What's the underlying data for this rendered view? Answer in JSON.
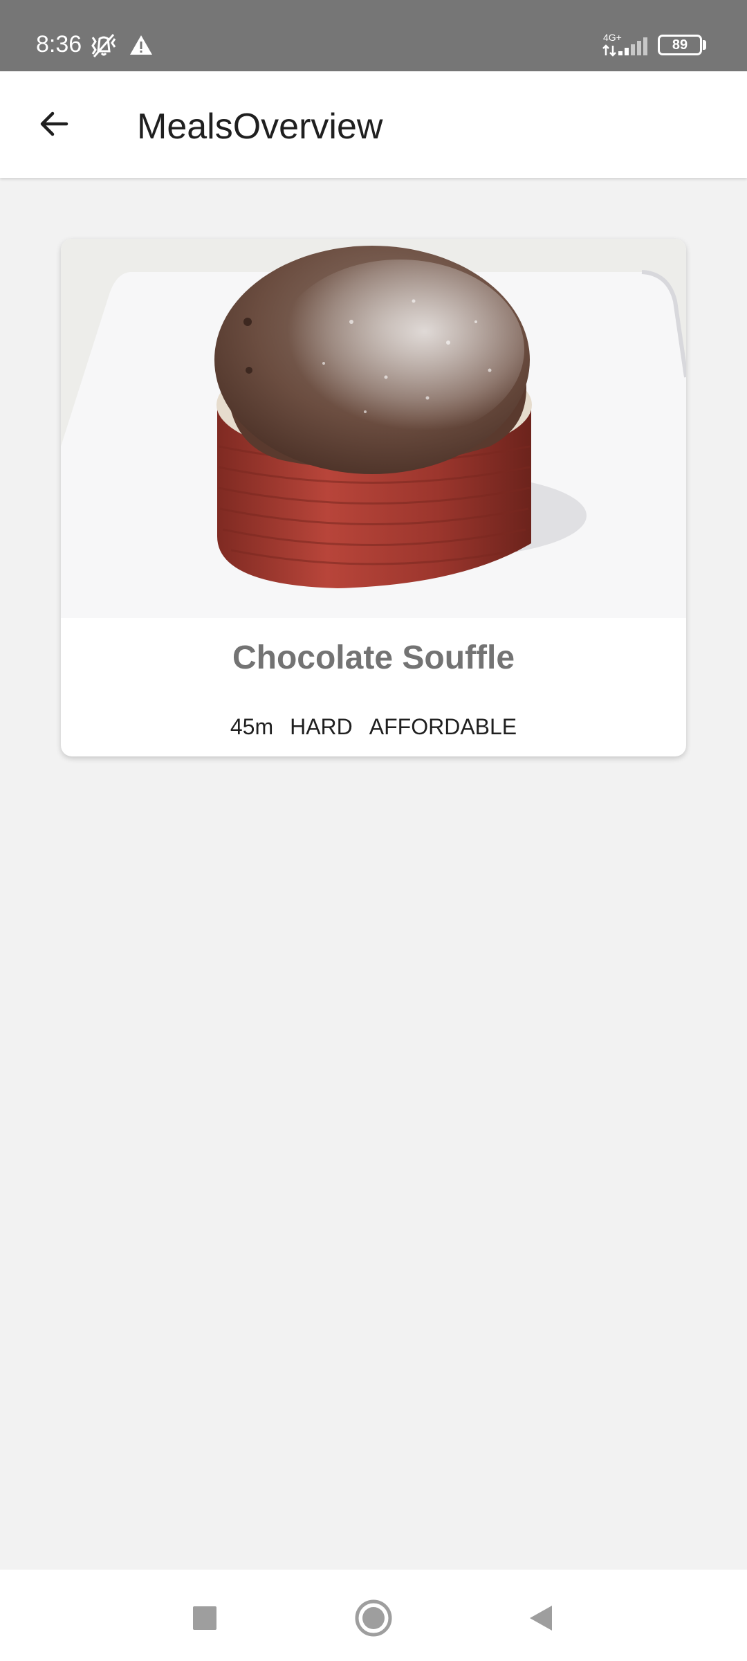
{
  "status_bar": {
    "time": "8:36",
    "network": "4G+",
    "battery": "89",
    "icons": [
      "vibrate-off-icon",
      "warning-icon",
      "signal-icon",
      "battery-icon"
    ]
  },
  "app_bar": {
    "title": "MealsOverview",
    "back_icon": "arrow-left-icon"
  },
  "meals": [
    {
      "name": "Chocolate Souffle",
      "duration": "45m",
      "complexity": "HARD",
      "affordability": "AFFORDABLE",
      "image": "chocolate-souffle-photo"
    }
  ],
  "nav_bar": {
    "icons": [
      "recents-square-icon",
      "home-circle-icon",
      "back-triangle-icon"
    ]
  },
  "colors": {
    "status_bar": "#767676",
    "background": "#f2f2f2",
    "card": "#ffffff",
    "meal_title": "#737373",
    "text": "#1f1f1f"
  }
}
